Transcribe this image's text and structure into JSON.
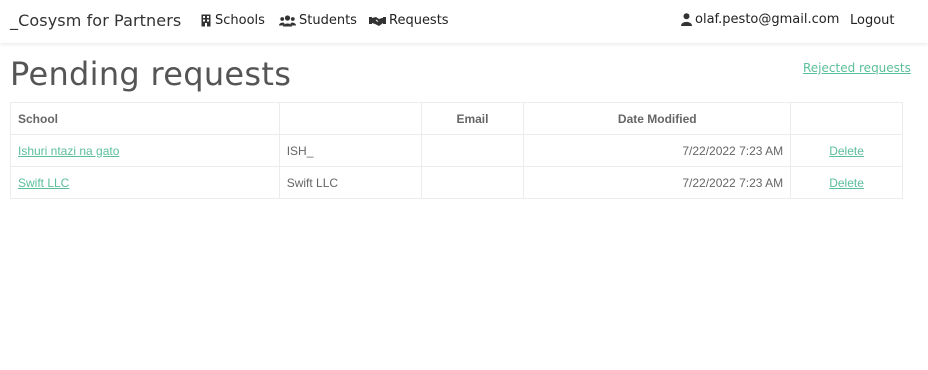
{
  "navbar": {
    "brand": "_Cosysm for Partners",
    "items": [
      {
        "label": "Schools",
        "icon": "building-icon"
      },
      {
        "label": "Students",
        "icon": "users-icon"
      },
      {
        "label": "Requests",
        "icon": "handshake-icon"
      }
    ],
    "user_email": "olaf.pesto@gmail.com",
    "logout_label": "Logout"
  },
  "page": {
    "title": "Pending requests",
    "rejected_link": "Rejected requests"
  },
  "table": {
    "headers": {
      "school": "School",
      "code": "",
      "email": "Email",
      "date_modified": "Date Modified",
      "action": ""
    },
    "rows": [
      {
        "school": "Ishuri ntazi na gato",
        "code": "ISH_",
        "email": "",
        "date_modified": "7/22/2022 7:23 AM",
        "action": "Delete"
      },
      {
        "school": "Swift LLC",
        "code": "Swift LLC",
        "email": "",
        "date_modified": "7/22/2022 7:23 AM",
        "action": "Delete"
      }
    ]
  },
  "colors": {
    "link": "#5bbf9a",
    "title": "#555555",
    "nav_text": "#222222"
  }
}
